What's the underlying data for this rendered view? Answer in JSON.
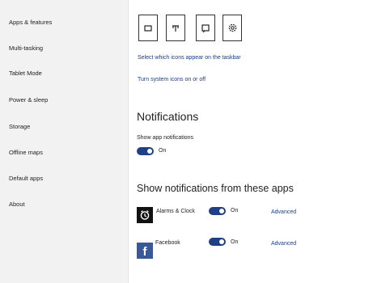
{
  "sidebar": {
    "items": [
      {
        "label": "Apps & features"
      },
      {
        "label": "Multi-tasking"
      },
      {
        "label": "Tablet Mode"
      },
      {
        "label": "Power & sleep"
      },
      {
        "label": "Storage"
      },
      {
        "label": "Offline maps"
      },
      {
        "label": "Default apps"
      },
      {
        "label": "About"
      }
    ]
  },
  "taskbar": {
    "icons": [
      "tablet-mode-icon",
      "network-icon",
      "action-center-icon",
      "settings-gear-icon"
    ],
    "select_icons_link": "Select which icons appear on the taskbar",
    "system_icons_link": "Turn system icons on or off"
  },
  "notifications": {
    "title": "Notifications",
    "show_app_notifications_label": "Show app notifications",
    "toggle_state": "On"
  },
  "app_notifications": {
    "title": "Show notifications from these apps",
    "apps": [
      {
        "name": "Alarms & Clock",
        "state": "On",
        "advanced": "Advanced",
        "icon": "alarm-clock-icon"
      },
      {
        "name": "Facebook",
        "state": "On",
        "advanced": "Advanced",
        "icon": "facebook-icon"
      }
    ]
  },
  "colors": {
    "accent": "#1f3f87",
    "link": "#1a3a8a",
    "sidebar_bg": "#f2f2f2"
  }
}
